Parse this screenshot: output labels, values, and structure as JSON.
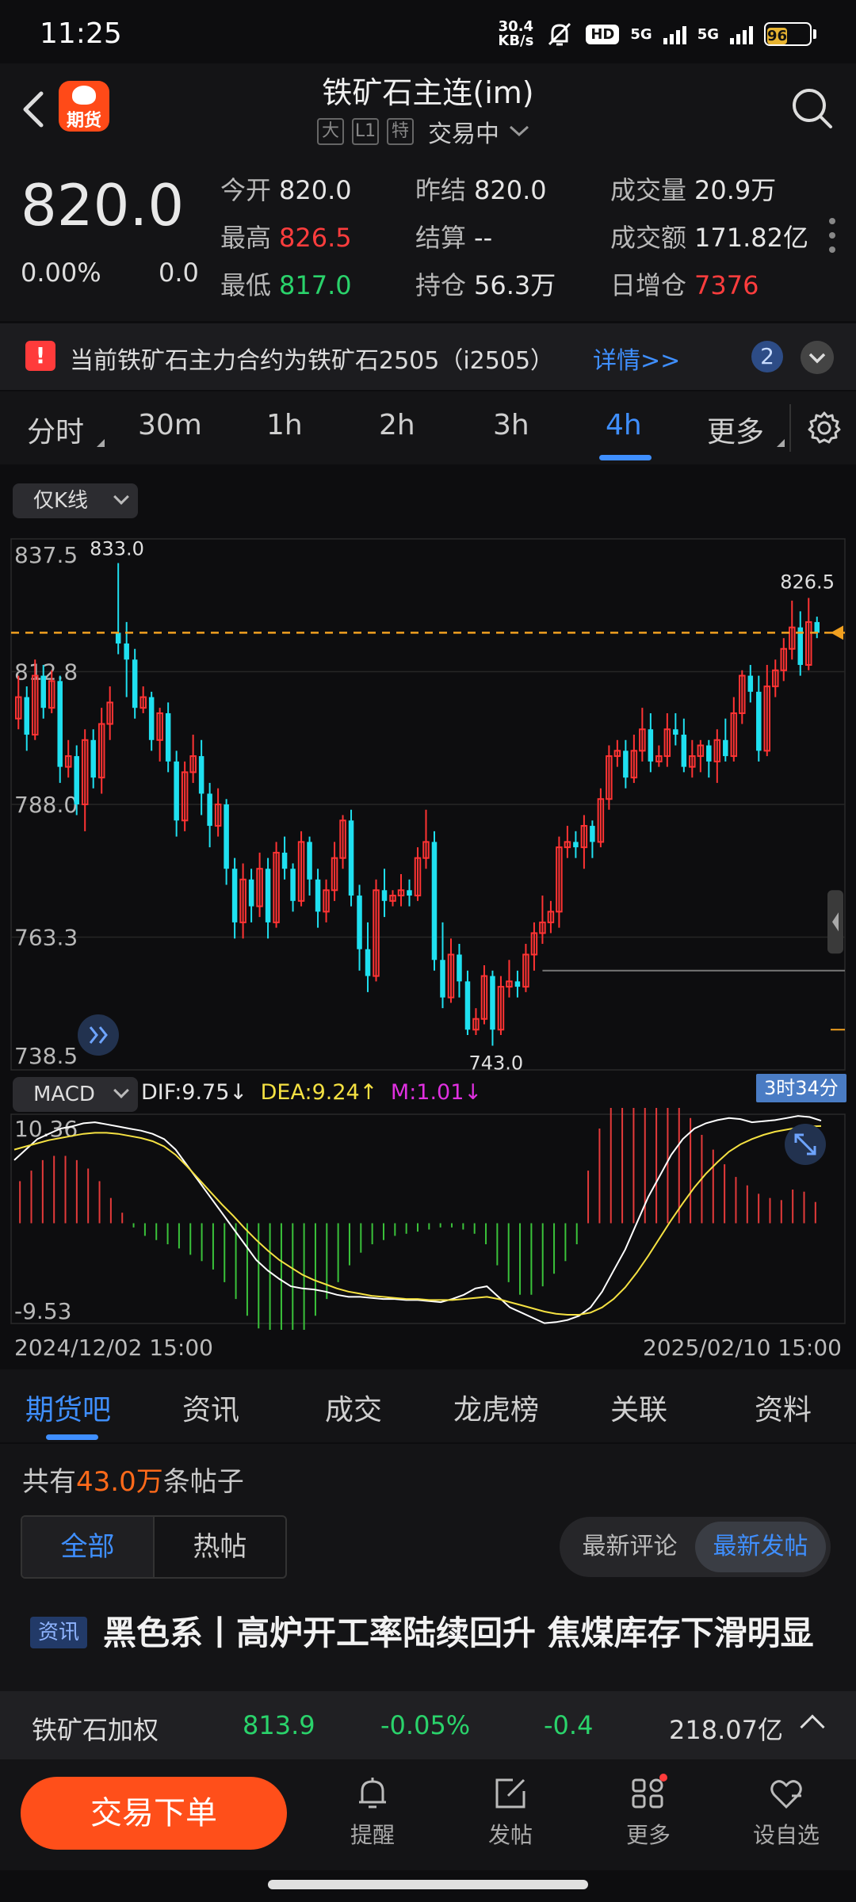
{
  "status_bar": {
    "time": "11:25",
    "net_speed_value": "30.4",
    "net_speed_unit": "KB/s",
    "hd": "HD",
    "net1": "5G",
    "net2": "5G",
    "battery": "96"
  },
  "header": {
    "logo_text": "期货",
    "title": "铁矿石主连(im)",
    "tags": [
      "大",
      "L1",
      "特"
    ],
    "status": "交易中"
  },
  "quote": {
    "last": "820.0",
    "change_pct": "0.00%",
    "change": "0.0",
    "open_label": "今开",
    "open": "820.0",
    "prev_label": "昨结",
    "prev": "820.0",
    "volume_label": "成交量",
    "volume": "20.9万",
    "high_label": "最高",
    "high": "826.5",
    "settle_label": "结算",
    "settle": "--",
    "amount_label": "成交额",
    "amount": "171.82亿",
    "low_label": "最低",
    "low": "817.0",
    "oi_label": "持仓",
    "oi": "56.3万",
    "oi_change_label": "日增仓",
    "oi_change": "7376"
  },
  "notice": {
    "text": "当前铁矿石主力合约为铁矿石2505（i2505）",
    "link": "详情>>",
    "count": "2"
  },
  "periods": {
    "items": [
      "分时",
      "30m",
      "1h",
      "2h",
      "3h",
      "4h",
      "更多"
    ],
    "active": "4h"
  },
  "chart": {
    "kline_mode": "仅K线",
    "indicator": "MACD",
    "dif": "DIF:9.75↓",
    "dea": "DEA:9.24↑",
    "m": "M:1.01↓",
    "timer": "3时34分",
    "date_start": "2024/12/02 15:00",
    "date_end": "2025/02/10 15:00",
    "colors": {
      "up": "#ff3333",
      "down": "#1fe0f0",
      "current_line": "#f0a020",
      "dif": "#ffffff",
      "dea": "#f5e142",
      "m": "#e030e0"
    }
  },
  "chart_data": {
    "type": "candlestick",
    "ylim": [
      738.5,
      837.5
    ],
    "y_ticks": [
      "837.5",
      "812.8",
      "788.0",
      "763.3",
      "738.5"
    ],
    "max_label": "833.0",
    "min_label": "743.0",
    "recent_high_label": "826.5",
    "current_price": 820.0,
    "candles": [
      {
        "o": 804,
        "c": 808,
        "h": 812,
        "l": 802
      },
      {
        "o": 808,
        "c": 801,
        "h": 810,
        "l": 798
      },
      {
        "o": 801,
        "c": 812,
        "h": 815,
        "l": 800
      },
      {
        "o": 812,
        "c": 806,
        "h": 814,
        "l": 804
      },
      {
        "o": 806,
        "c": 811,
        "h": 813,
        "l": 805
      },
      {
        "o": 811,
        "c": 795,
        "h": 812,
        "l": 792
      },
      {
        "o": 795,
        "c": 797,
        "h": 800,
        "l": 793
      },
      {
        "o": 797,
        "c": 788,
        "h": 799,
        "l": 786
      },
      {
        "o": 788,
        "c": 800,
        "h": 802,
        "l": 783
      },
      {
        "o": 800,
        "c": 793,
        "h": 802,
        "l": 791
      },
      {
        "o": 793,
        "c": 803,
        "h": 806,
        "l": 790
      },
      {
        "o": 803,
        "c": 807,
        "h": 810,
        "l": 800
      },
      {
        "o": 820,
        "c": 818,
        "h": 833,
        "l": 816
      },
      {
        "o": 818,
        "c": 815,
        "h": 822,
        "l": 808
      },
      {
        "o": 815,
        "c": 806,
        "h": 817,
        "l": 804
      },
      {
        "o": 806,
        "c": 808,
        "h": 810,
        "l": 805
      },
      {
        "o": 808,
        "c": 800,
        "h": 809,
        "l": 798
      },
      {
        "o": 800,
        "c": 805,
        "h": 806,
        "l": 796
      },
      {
        "o": 805,
        "c": 796,
        "h": 807,
        "l": 794
      },
      {
        "o": 796,
        "c": 785,
        "h": 798,
        "l": 782
      },
      {
        "o": 785,
        "c": 794,
        "h": 796,
        "l": 783
      },
      {
        "o": 794,
        "c": 797,
        "h": 801,
        "l": 792
      },
      {
        "o": 797,
        "c": 790,
        "h": 800,
        "l": 786
      },
      {
        "o": 790,
        "c": 784,
        "h": 792,
        "l": 780
      },
      {
        "o": 784,
        "c": 788,
        "h": 791,
        "l": 782
      },
      {
        "o": 788,
        "c": 776,
        "h": 789,
        "l": 773
      },
      {
        "o": 776,
        "c": 766,
        "h": 778,
        "l": 763
      },
      {
        "o": 766,
        "c": 774,
        "h": 777,
        "l": 763
      },
      {
        "o": 774,
        "c": 769,
        "h": 776,
        "l": 766
      },
      {
        "o": 769,
        "c": 776,
        "h": 779,
        "l": 767
      },
      {
        "o": 776,
        "c": 766,
        "h": 778,
        "l": 763
      },
      {
        "o": 766,
        "c": 779,
        "h": 781,
        "l": 765
      },
      {
        "o": 779,
        "c": 776,
        "h": 782,
        "l": 774
      },
      {
        "o": 776,
        "c": 770,
        "h": 777,
        "l": 768
      },
      {
        "o": 770,
        "c": 781,
        "h": 783,
        "l": 769
      },
      {
        "o": 781,
        "c": 774,
        "h": 782,
        "l": 771
      },
      {
        "o": 774,
        "c": 768,
        "h": 776,
        "l": 765
      },
      {
        "o": 768,
        "c": 772,
        "h": 774,
        "l": 766
      },
      {
        "o": 772,
        "c": 778,
        "h": 781,
        "l": 770
      },
      {
        "o": 778,
        "c": 785,
        "h": 786,
        "l": 776
      },
      {
        "o": 785,
        "c": 771,
        "h": 787,
        "l": 769
      },
      {
        "o": 771,
        "c": 761,
        "h": 773,
        "l": 757
      },
      {
        "o": 761,
        "c": 756,
        "h": 766,
        "l": 753
      },
      {
        "o": 756,
        "c": 772,
        "h": 774,
        "l": 755
      },
      {
        "o": 772,
        "c": 770,
        "h": 776,
        "l": 767
      },
      {
        "o": 770,
        "c": 771,
        "h": 772,
        "l": 769
      },
      {
        "o": 771,
        "c": 772,
        "h": 775,
        "l": 769
      },
      {
        "o": 772,
        "c": 771,
        "h": 774,
        "l": 769
      },
      {
        "o": 771,
        "c": 778,
        "h": 780,
        "l": 770
      },
      {
        "o": 778,
        "c": 781,
        "h": 787,
        "l": 776
      },
      {
        "o": 781,
        "c": 759,
        "h": 783,
        "l": 757
      },
      {
        "o": 759,
        "c": 752,
        "h": 766,
        "l": 750
      },
      {
        "o": 752,
        "c": 760,
        "h": 763,
        "l": 751
      },
      {
        "o": 760,
        "c": 755,
        "h": 762,
        "l": 752
      },
      {
        "o": 755,
        "c": 746,
        "h": 757,
        "l": 745
      },
      {
        "o": 746,
        "c": 748,
        "h": 750,
        "l": 745
      },
      {
        "o": 748,
        "c": 756,
        "h": 758,
        "l": 747
      },
      {
        "o": 756,
        "c": 746,
        "h": 757,
        "l": 743
      },
      {
        "o": 746,
        "c": 754,
        "h": 756,
        "l": 745
      },
      {
        "o": 754,
        "c": 755,
        "h": 759,
        "l": 752
      },
      {
        "o": 755,
        "c": 754,
        "h": 757,
        "l": 752
      },
      {
        "o": 754,
        "c": 760,
        "h": 762,
        "l": 753
      },
      {
        "o": 760,
        "c": 764,
        "h": 766,
        "l": 757
      },
      {
        "o": 764,
        "c": 766,
        "h": 771,
        "l": 762
      },
      {
        "o": 766,
        "c": 768,
        "h": 770,
        "l": 764
      },
      {
        "o": 768,
        "c": 780,
        "h": 782,
        "l": 765
      },
      {
        "o": 780,
        "c": 781,
        "h": 784,
        "l": 778
      },
      {
        "o": 781,
        "c": 780,
        "h": 783,
        "l": 778
      },
      {
        "o": 780,
        "c": 784,
        "h": 786,
        "l": 776
      },
      {
        "o": 784,
        "c": 781,
        "h": 785,
        "l": 778
      },
      {
        "o": 781,
        "c": 789,
        "h": 791,
        "l": 780
      },
      {
        "o": 789,
        "c": 797,
        "h": 799,
        "l": 787
      },
      {
        "o": 797,
        "c": 798,
        "h": 800,
        "l": 795
      },
      {
        "o": 798,
        "c": 793,
        "h": 800,
        "l": 791
      },
      {
        "o": 793,
        "c": 798,
        "h": 801,
        "l": 792
      },
      {
        "o": 798,
        "c": 802,
        "h": 806,
        "l": 796
      },
      {
        "o": 802,
        "c": 796,
        "h": 805,
        "l": 794
      },
      {
        "o": 796,
        "c": 797,
        "h": 799,
        "l": 795
      },
      {
        "o": 797,
        "c": 802,
        "h": 805,
        "l": 795
      },
      {
        "o": 802,
        "c": 801,
        "h": 805,
        "l": 799
      },
      {
        "o": 801,
        "c": 795,
        "h": 804,
        "l": 794
      },
      {
        "o": 795,
        "c": 797,
        "h": 800,
        "l": 793
      },
      {
        "o": 797,
        "c": 799,
        "h": 800,
        "l": 794
      },
      {
        "o": 799,
        "c": 796,
        "h": 800,
        "l": 793
      },
      {
        "o": 796,
        "c": 800,
        "h": 802,
        "l": 792
      },
      {
        "o": 800,
        "c": 797,
        "h": 804,
        "l": 796
      },
      {
        "o": 797,
        "c": 805,
        "h": 808,
        "l": 796
      },
      {
        "o": 805,
        "c": 812,
        "h": 813,
        "l": 803
      },
      {
        "o": 812,
        "c": 809,
        "h": 814,
        "l": 807
      },
      {
        "o": 809,
        "c": 798,
        "h": 812,
        "l": 796
      },
      {
        "o": 798,
        "c": 810,
        "h": 814,
        "l": 797
      },
      {
        "o": 810,
        "c": 813,
        "h": 815,
        "l": 808
      },
      {
        "o": 813,
        "c": 817,
        "h": 819,
        "l": 811
      },
      {
        "o": 817,
        "c": 821,
        "h": 826,
        "l": 815
      },
      {
        "o": 821,
        "c": 814,
        "h": 824,
        "l": 812
      },
      {
        "o": 814,
        "c": 822,
        "h": 826.5,
        "l": 813
      },
      {
        "o": 822,
        "c": 820,
        "h": 823,
        "l": 819
      }
    ],
    "macd": {
      "ylim": [
        -9.53,
        10.36
      ],
      "y_ticks": [
        "10.36",
        "-9.53"
      ],
      "dif": [
        6,
        7,
        8,
        8.5,
        9,
        9.2,
        9.5,
        9.6,
        9.4,
        9.2,
        9,
        8.8,
        8.5,
        8,
        7,
        5.5,
        4,
        2.5,
        1,
        -0.5,
        -2,
        -3.5,
        -4.5,
        -5.3,
        -6,
        -6.2,
        -6.3,
        -6.5,
        -6.8,
        -7,
        -7,
        -7.1,
        -7.2,
        -7.2,
        -7.3,
        -7.3,
        -7.4,
        -7.5,
        -7.2,
        -6.8,
        -6.2,
        -6,
        -7,
        -8,
        -8.5,
        -9,
        -9.5,
        -9.4,
        -9.2,
        -8.8,
        -8,
        -6.5,
        -4.5,
        -2.5,
        0,
        2.5,
        4.5,
        6.5,
        8,
        9,
        9.5,
        9.8,
        10,
        9.9,
        9.6,
        9.7,
        9.8,
        10,
        10.2,
        10.1,
        9.75
      ],
      "dea": [
        7,
        7.3,
        7.6,
        7.9,
        8.1,
        8.3,
        8.5,
        8.6,
        8.6,
        8.5,
        8.3,
        8.1,
        7.8,
        7.3,
        6.5,
        5.4,
        4.2,
        3,
        1.8,
        0.7,
        -0.5,
        -1.6,
        -2.6,
        -3.5,
        -4.2,
        -4.9,
        -5.4,
        -5.8,
        -6.2,
        -6.5,
        -6.7,
        -6.9,
        -7,
        -7.1,
        -7.2,
        -7.2,
        -7.3,
        -7.3,
        -7.3,
        -7.2,
        -7.1,
        -7,
        -7.2,
        -7.5,
        -7.8,
        -8.1,
        -8.4,
        -8.6,
        -8.7,
        -8.7,
        -8.5,
        -8,
        -7.2,
        -6.1,
        -4.7,
        -3.1,
        -1.4,
        0.3,
        1.9,
        3.4,
        4.7,
        5.8,
        6.8,
        7.5,
        8,
        8.4,
        8.7,
        8.9,
        9.1,
        9.2,
        9.24
      ],
      "hist": [
        2,
        2.5,
        3,
        3.2,
        3.2,
        3,
        2.6,
        2,
        1.2,
        0.5,
        -0.2,
        -0.6,
        -0.8,
        -1,
        -1.2,
        -1.5,
        -1.8,
        -2.2,
        -2.8,
        -3.6,
        -4.4,
        -5,
        -5.6,
        -6,
        -5.8,
        -5.2,
        -4.4,
        -3.6,
        -2.8,
        -2,
        -1.4,
        -1,
        -0.8,
        -0.6,
        -0.5,
        -0.4,
        -0.3,
        -0.2,
        -0.2,
        -0.3,
        -0.5,
        -1,
        -2,
        -2.8,
        -3.4,
        -3.4,
        -3,
        -2.4,
        -1.8,
        -1,
        2.5,
        4.5,
        5.8,
        6.8,
        7.4,
        7.6,
        7.2,
        6.6,
        5.8,
        5,
        4.2,
        3.5,
        2.8,
        2.2,
        1.8,
        1.4,
        1.2,
        1.1,
        1.6,
        1.5,
        1.01
      ]
    }
  },
  "sections": {
    "items": [
      "期货吧",
      "资讯",
      "成交",
      "龙虎榜",
      "关联",
      "资料"
    ],
    "active": "期货吧"
  },
  "posts": {
    "count_prefix": "共有",
    "count_value": "43.0万",
    "count_suffix": "条帖子",
    "filters": [
      "全部",
      "热帖"
    ],
    "sorts": [
      "最新评论",
      "最新发帖"
    ],
    "first_tag": "资讯",
    "first_title": "黑色系丨高炉开工率陆续回升 焦煤库存下滑明显"
  },
  "ticker": {
    "name": "铁矿石加权",
    "price": "813.9",
    "pct": "-0.05%",
    "change": "-0.4",
    "amount": "218.07亿"
  },
  "bottom_nav": {
    "order_label": "交易下单",
    "items": [
      "提醒",
      "发帖",
      "更多",
      "设自选"
    ]
  }
}
